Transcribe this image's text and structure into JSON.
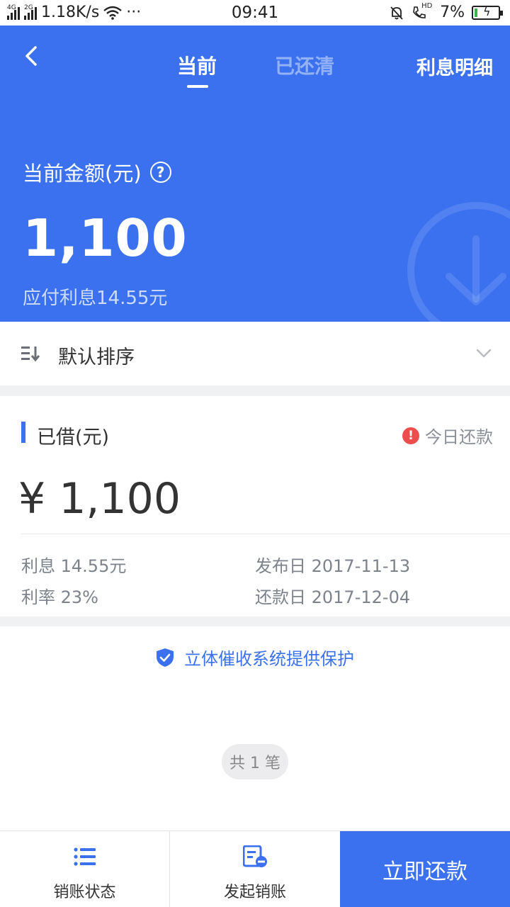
{
  "status_bar": {
    "net_4g": "4G",
    "net_2g": "2G",
    "speed": "1.18K/s",
    "dots": "···",
    "time": "09:41",
    "hd": "HD",
    "battery": "7%"
  },
  "header": {
    "tabs": [
      {
        "label": "当前",
        "active": true
      },
      {
        "label": "已还清",
        "active": false
      }
    ],
    "interest_detail": "利息明细",
    "amount_label": "当前金额(元)",
    "help_icon": "?",
    "amount": "1,100",
    "interest_due": "应付利息14.55元",
    "bg_color": "#3b71ef"
  },
  "sort": {
    "label": "默认排序"
  },
  "loan": {
    "title": "已借(元)",
    "due_badge_icon": "!",
    "due_badge": "今日还款",
    "amount": "¥ 1,100",
    "interest": "利息 14.55元",
    "rate": "利率 23%",
    "publish_date": "发布日 2017-11-13",
    "repay_date": "还款日 2017-12-04"
  },
  "protection_text": "立体催收系统提供保护",
  "count_text": "共 1 笔",
  "bottom_bar": {
    "status_label": "销账状态",
    "start_label": "发起销账",
    "pay_label": "立即还款"
  }
}
